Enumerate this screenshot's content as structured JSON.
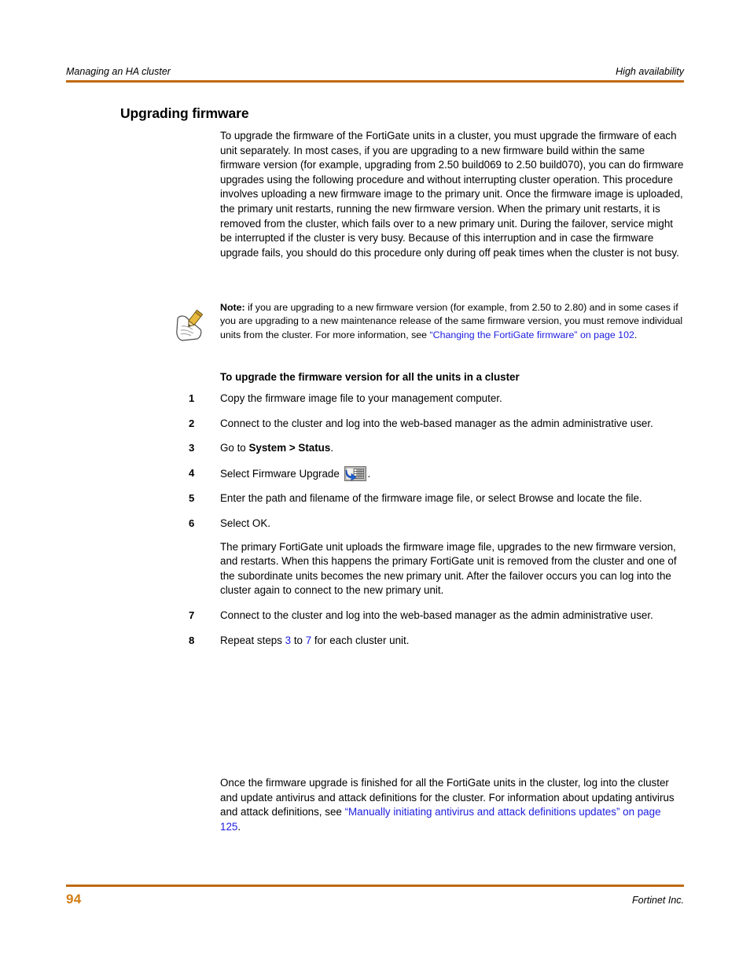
{
  "document": {
    "running_header_left": "Managing an HA cluster",
    "running_header_right": "High availability",
    "footer_page_number": "94",
    "footer_publisher": "Fortinet Inc.",
    "rule_color": "#bf6a11",
    "page_number_color": "#d27d12",
    "link_color": "#1d1de0"
  },
  "section": {
    "title": "Upgrading firmware",
    "intro_paragraph": "To upgrade the firmware of the FortiGate units in a cluster, you must upgrade the firmware of each unit separately. In most cases, if you are upgrading to a new firmware build within the same firmware version (for example, upgrading from 2.50 build069 to 2.50 build070), you can do firmware upgrades using the following procedure and without interrupting cluster operation. This procedure involves uploading a new firmware image to the primary unit. Once the firmware image is uploaded, the primary unit restarts, running the new firmware version. When the primary unit restarts, it is removed from the cluster, which fails over to a new primary unit. During the failover, service might be interrupted if the cluster is very busy. Because of this interruption and in case the firmware upgrade fails, you should do this procedure only during off peak times when the cluster is not busy."
  },
  "note": {
    "icon": "note-pencil-icon",
    "label": "Note:",
    "text_before_link": " if you are upgrading to a new firmware version (for example, from 2.50 to 2.80) and in some cases if you are upgrading to a new maintenance release of the same firmware version, you must remove individual units from the cluster. For more information, see ",
    "link_text": "“Changing the FortiGate firmware” on page 102",
    "text_after_link": "."
  },
  "procedure": {
    "heading": "To upgrade the firmware version for all the units in a cluster",
    "steps": [
      {
        "number": "1",
        "text": "Copy the firmware image file to your management computer."
      },
      {
        "number": "2",
        "text": "Connect to the cluster and log into the web-based manager as the admin administrative user."
      },
      {
        "number": "3",
        "text_before_bold": "Go to ",
        "bold": "System > Status",
        "text_after_bold": "."
      },
      {
        "number": "4",
        "text_before_icon": "Select Firmware Upgrade ",
        "icon": "firmware-upgrade-icon",
        "text_after_icon": "."
      },
      {
        "number": "5",
        "text": "Enter the path and filename of the firmware image file, or select Browse and locate the file."
      },
      {
        "number": "6",
        "text": "Select OK.",
        "continuation": "The primary FortiGate unit uploads the firmware image file, upgrades to the new firmware version, and restarts. When this happens the primary FortiGate unit is removed from the cluster and one of the subordinate units becomes the new primary unit. After the failover occurs you can log into the cluster again to connect to the new primary unit."
      },
      {
        "number": "7",
        "text": "Connect to the cluster and log into the web-based manager as the admin administrative user."
      },
      {
        "number": "8",
        "text_part1": "Repeat steps ",
        "link1": "3",
        "text_part2": " to ",
        "link2": "7",
        "text_part3": " for each cluster unit."
      }
    ],
    "closing_paragraph_before_link": "Once the firmware upgrade is finished for all the FortiGate units in the cluster, log into the cluster and update antivirus and attack definitions for the cluster. For information about updating antivirus and attack definitions, see ",
    "closing_paragraph_link": "“Manually initiating antivirus and attack definitions updates” on page 125",
    "closing_paragraph_after_link": "."
  }
}
